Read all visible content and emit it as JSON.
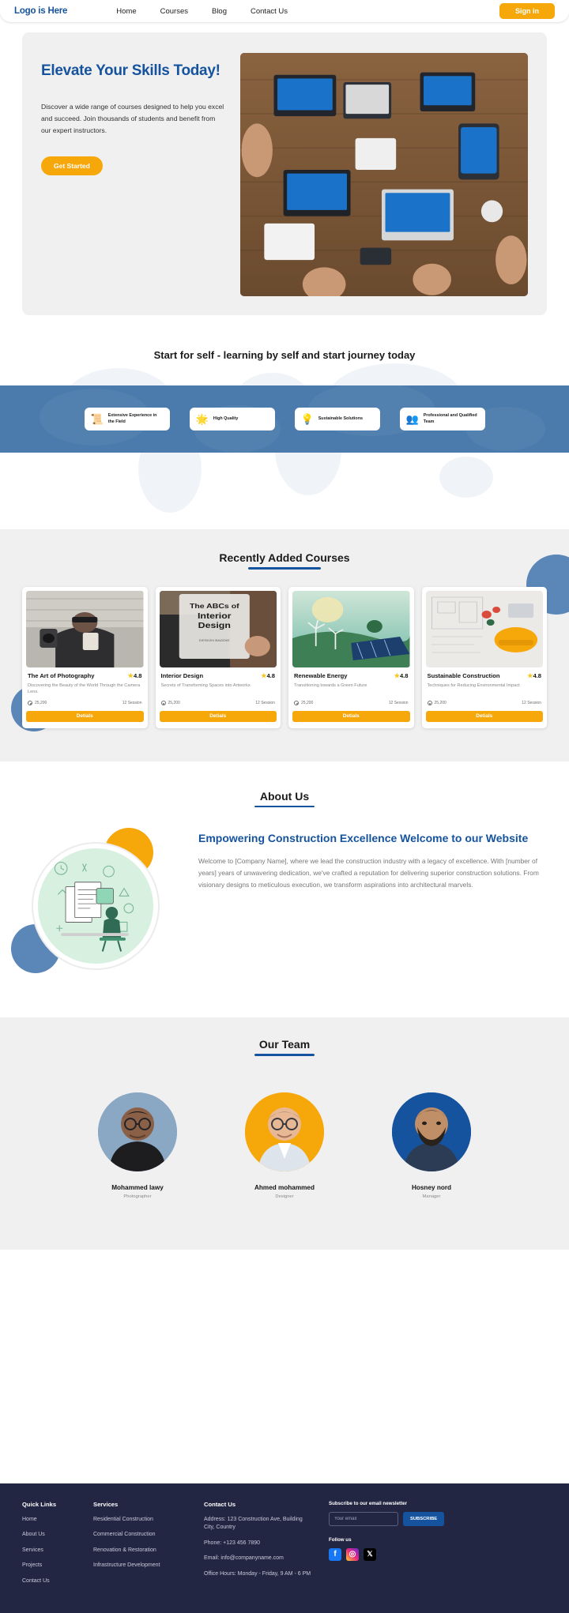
{
  "header": {
    "logo": "Logo is Here",
    "nav": [
      {
        "label": "Home"
      },
      {
        "label": "Courses"
      },
      {
        "label": "Blog"
      },
      {
        "label": "Contact Us"
      }
    ],
    "signin_label": "Sign in"
  },
  "hero": {
    "title": "Elevate Your Skills Today!",
    "paragraph": "Discover a wide range of courses designed to help you excel and succeed. Join thousands of students and benefit from our expert instructors.",
    "cta_label": "Get Started",
    "image_alt": "team-working-on-laptops-top-view"
  },
  "midband": {
    "title": "Start for self - learning by self and start journey today",
    "features": [
      {
        "icon": "certificate-icon",
        "emoji": "📜",
        "label": "Extensive Experience in the Field"
      },
      {
        "icon": "quality-star-icon",
        "emoji": "🌟",
        "label": "High Quality"
      },
      {
        "icon": "lightbulb-hand-icon",
        "emoji": "💡",
        "label": "Sustainable Solutions"
      },
      {
        "icon": "team-group-icon",
        "emoji": "👥",
        "label": "Professional and Qualified Team"
      }
    ],
    "band_color": "#4a7bac"
  },
  "courses": {
    "section_title": "Recently Added Courses",
    "items": [
      {
        "title": "The Art of Photography",
        "rating": "4.8",
        "description": "Discovering the Beauty of the World Through the Camera Lens.",
        "views": "25,200",
        "sessions": "12 Session",
        "button_label": "Detials",
        "image_alt": "photographer-with-video-camera"
      },
      {
        "title": "Interior Design",
        "rating": "4.8",
        "description": "Secrets of Transforming Spaces into Artworks",
        "views": "25,200",
        "sessions": "12 Session",
        "button_label": "Detials",
        "image_alt": "the-abcs-of-interior-design-book-cover"
      },
      {
        "title": "Renewable Energy",
        "rating": "4.8",
        "description": "Transitioning towards a Green Future",
        "views": "25,200",
        "sessions": "12 Session",
        "button_label": "Detials",
        "image_alt": "solar-panels-and-wind-turbines-on-green-earth"
      },
      {
        "title": "Sustainable Construction",
        "rating": "4.8",
        "description": "Techniques for Reducing Environmental Impact",
        "views": "25,200",
        "sessions": "12 Session",
        "button_label": "Detials",
        "image_alt": "blueprints-with-hard-hat-and-tools"
      }
    ]
  },
  "about": {
    "section_title": "About Us",
    "heading": "Empowering Construction Excellence Welcome to our Website",
    "paragraph": "Welcome to [Company Name], where we lead the construction industry with a legacy of excellence. With [number of years] years of unwavering dedication, we've crafted a reputation for delivering superior construction solutions. From visionary designs to meticulous execution, we transform aspirations into architectural marvels.",
    "image_alt": "illustration-student-studying-at-desk-with-math-icons"
  },
  "team": {
    "section_title": "Our Team",
    "members": [
      {
        "name": "Mohammed lawy",
        "role": "Photographer",
        "image_alt": "man-with-glasses-in-black-shirt",
        "bg": "#8aa7c4"
      },
      {
        "name": "Ahmed mohammed",
        "role": "Designer",
        "image_alt": "smiling-man-with-glasses-in-light-shirt",
        "bg": "#f6a70a"
      },
      {
        "name": "Hosney nord",
        "role": "Manager",
        "image_alt": "bearded-man-in-dark-blue-shirt",
        "bg": "#15539e"
      }
    ]
  },
  "footer": {
    "quick_links": {
      "heading": "Quick Links",
      "items": [
        "Home",
        "About Us",
        "Services",
        "Projects",
        "Contact Us"
      ]
    },
    "services": {
      "heading": "Services",
      "items": [
        "Residential Construction",
        "Commercial Construction",
        "Renovation & Restoration",
        "Infrastructure Development"
      ]
    },
    "contact": {
      "heading": "Contact Us",
      "items": [
        "Address: 123 Construction Ave, Building City, Country",
        "Phone: +123 456 7890",
        "Email: info@companyname.com",
        "Office Hours: Monday - Friday, 9 AM - 6 PM"
      ]
    },
    "subscribe": {
      "heading": "Subscribe to our email newsletter",
      "input_placeholder": "Your email",
      "input_value": "",
      "button_label": "SUBSCRIBE"
    },
    "follow": {
      "heading": "Follow us",
      "socials": [
        {
          "name": "facebook-icon",
          "glyph": "f"
        },
        {
          "name": "instagram-icon",
          "glyph": "◎"
        },
        {
          "name": "x-twitter-icon",
          "glyph": "𝕏"
        }
      ]
    }
  }
}
